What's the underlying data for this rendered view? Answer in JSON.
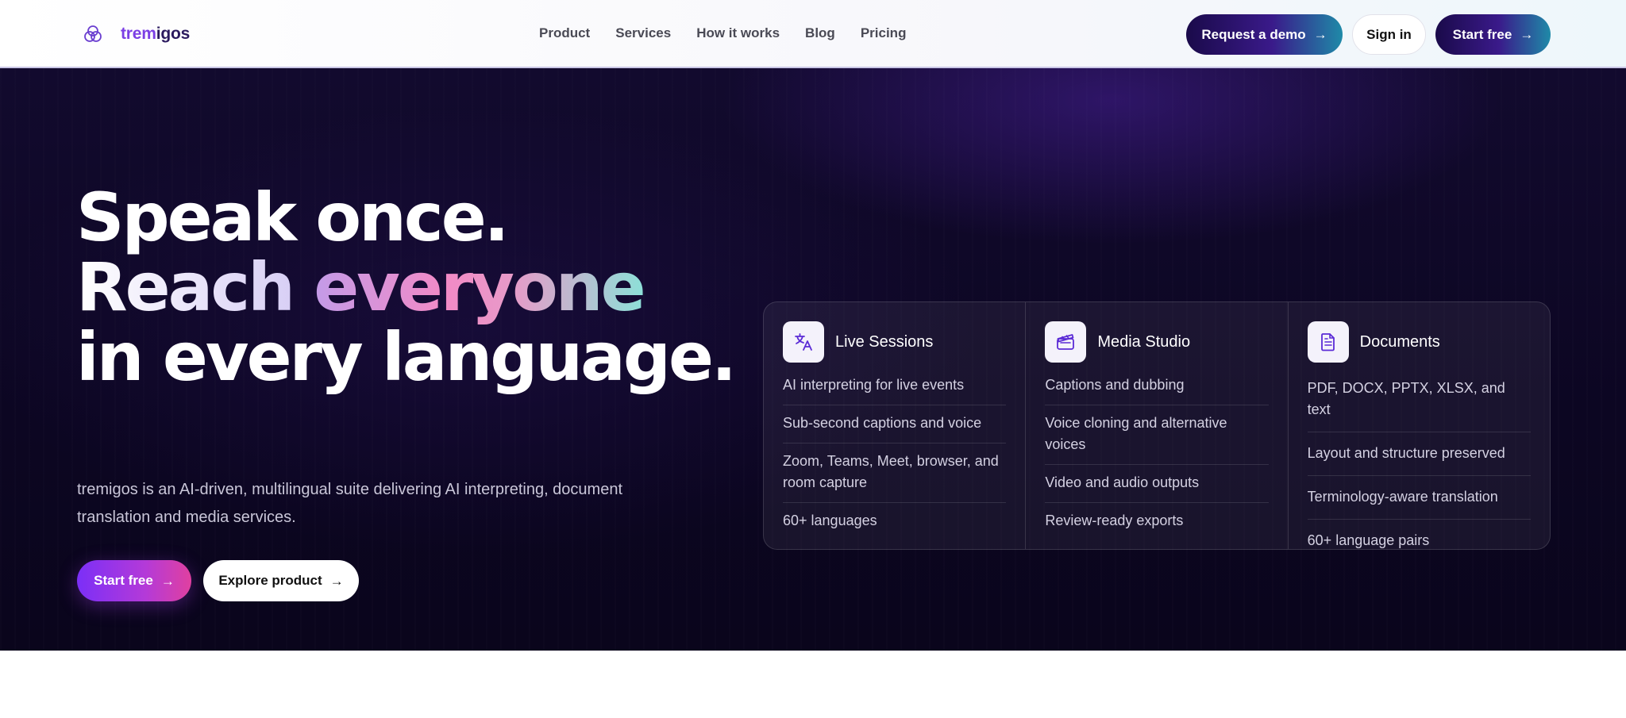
{
  "header": {
    "logo": {
      "prefix": "trem",
      "suffix": "igos"
    },
    "nav": [
      "Product",
      "Services",
      "How it works",
      "Blog",
      "Pricing"
    ],
    "request_demo": "Request a demo",
    "sign_in": "Sign in",
    "start_free": "Start free"
  },
  "hero": {
    "headline": {
      "line1": "Speak once.",
      "line2_a": "Reach",
      "line2_b": "everyone",
      "line3": "in every language."
    },
    "subtitle": "tremigos is an AI-driven, multilingual suite delivering AI interpreting, document translation and media services.",
    "start_free": "Start free",
    "explore": "Explore product"
  },
  "features": [
    {
      "title": "Live Sessions",
      "icon": "translate-icon",
      "items": [
        "AI interpreting for live events",
        "Sub-second captions and voice",
        "Zoom, Teams, Meet, browser, and room capture",
        "60+ languages"
      ]
    },
    {
      "title": "Media Studio",
      "icon": "clapperboard-icon",
      "items": [
        "Captions and dubbing",
        "Voice cloning and alternative voices",
        "Video and audio outputs",
        "Review-ready exports"
      ]
    },
    {
      "title": "Documents",
      "icon": "document-icon",
      "items": [
        "PDF, DOCX, PPTX, XLSX, and text",
        "Layout and structure preserved",
        "Terminology-aware translation",
        "60+ language pairs"
      ]
    }
  ],
  "colors": {
    "brand_purple": "#7b3fe4",
    "hero_bg": "#0c0622",
    "icon_purple": "#5b2bd6"
  }
}
